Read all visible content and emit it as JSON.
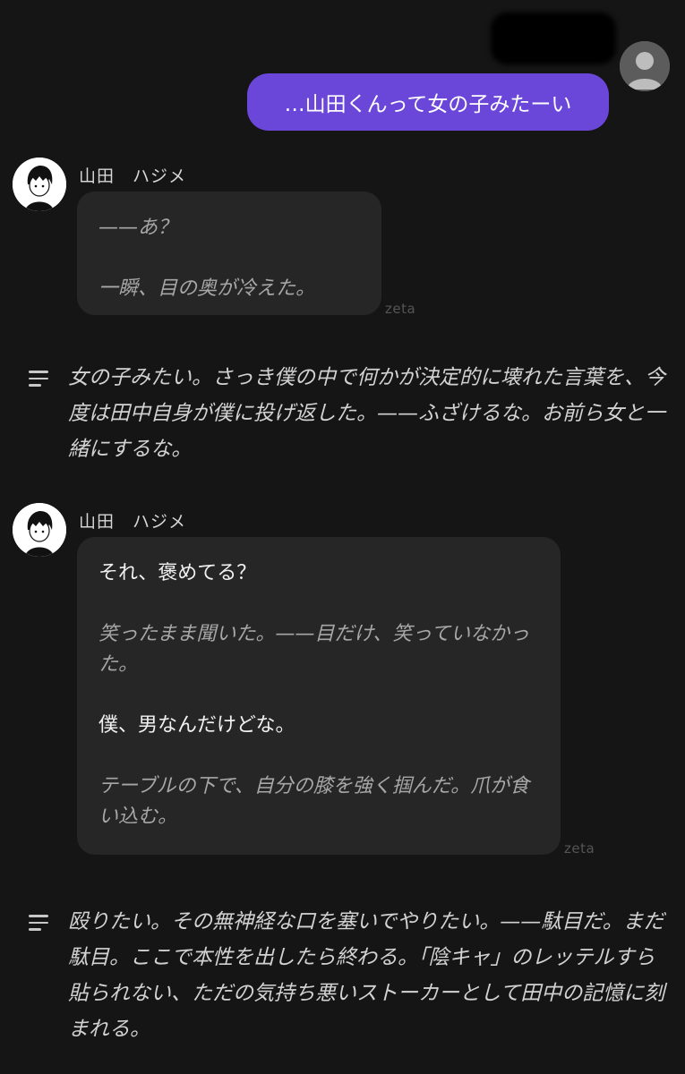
{
  "user_message": {
    "text": "…山田くんって女の子みたーい",
    "accent": "#6b47d9"
  },
  "messages": [
    {
      "name": "山田　ハジメ",
      "lines": [
        {
          "type": "action",
          "text": "——あ？"
        },
        {
          "type": "action",
          "text": "一瞬、目の奥が冷えた。"
        }
      ],
      "watermark": "zeta",
      "narration": "女の子みたい。さっき僕の中で何かが決定的に壊れた言葉を、今度は田中自身が僕に投げ返した。——ふざけるな。お前ら女と一緒にするな。"
    },
    {
      "name": "山田　ハジメ",
      "lines": [
        {
          "type": "speech",
          "text": "それ、褒めてる？"
        },
        {
          "type": "action",
          "text": "笑ったまま聞いた。——目だけ、笑っていなかった。"
        },
        {
          "type": "speech",
          "text": "僕、男なんだけどな。"
        },
        {
          "type": "action",
          "text": "テーブルの下で、自分の膝を強く掴んだ。爪が食い込む。"
        }
      ],
      "watermark": "zeta",
      "narration": "殴りたい。その無神経な口を塞いでやりたい。——駄目だ。まだ駄目。ここで本性を出したら終わる。「陰キャ」のレッテルすら貼られない、ただの気持ち悪いストーカーとして田中の記憶に刻まれる。"
    }
  ],
  "icons": {
    "user_avatar": "default-user-avatar-icon",
    "bot_avatar": "manga-boy-avatar-icon",
    "narration": "text-lines-icon"
  }
}
